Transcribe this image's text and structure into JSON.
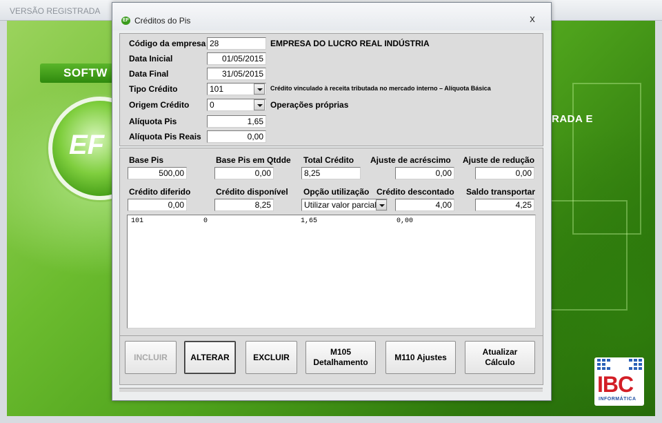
{
  "app": {
    "title": "VERSÃO REGISTRADA",
    "banner": "SOFTW",
    "logo": "EF",
    "side_text": "RADA E",
    "ibc_brand": "IBC",
    "ibc_sub": "INFORMÁTICA"
  },
  "dialog": {
    "title": "Créditos do Pis",
    "icon_text": "EF",
    "close": "x"
  },
  "header": {
    "codigo_label": "Código da empresa",
    "codigo_value": "28",
    "empresa_nome": "EMPRESA DO LUCRO REAL INDÚSTRIA",
    "data_inicial_label": "Data Inicial",
    "data_inicial_value": "01/05/2015",
    "data_final_label": "Data Final",
    "data_final_value": "31/05/2015",
    "tipo_credito_label": "Tipo Crédito",
    "tipo_credito_value": "101",
    "tipo_credito_desc": "Crédito vinculado à receita tributada no mercado interno – Alíquota Básica",
    "origem_label": "Origem Crédito",
    "origem_value": "0",
    "origem_desc": "Operações próprias",
    "aliquota_label": "Alíquota Pis",
    "aliquota_value": "1,65",
    "aliquota_reais_label": "Alíquota Pis Reais",
    "aliquota_reais_value": "0,00"
  },
  "calc": {
    "base_pis_label": "Base Pis",
    "base_pis_value": "500,00",
    "base_qtdde_label": "Base Pis em Qtdde",
    "base_qtdde_value": "0,00",
    "total_credito_label": "Total Crédito",
    "total_credito_value": "8,25",
    "ajuste_acrescimo_label": "Ajuste de acréscimo",
    "ajuste_acrescimo_value": "0,00",
    "ajuste_reducao_label": "Ajuste de redução",
    "ajuste_reducao_value": "0,00",
    "credito_diferido_label": "Crédito diferido",
    "credito_diferido_value": "0,00",
    "credito_disponivel_label": "Crédito disponível",
    "credito_disponivel_value": "8,25",
    "opcao_label": "Opção utilização",
    "opcao_value": "Utilizar valor parcial",
    "credito_descontado_label": "Crédito descontado",
    "credito_descontado_value": "4,00",
    "saldo_label": "Saldo transportar",
    "saldo_value": "4,25"
  },
  "grid": {
    "row1": [
      "101",
      "0",
      "1,65",
      "0,00"
    ]
  },
  "buttons": {
    "incluir": "INCLUIR",
    "alterar": "ALTERAR",
    "excluir": "EXCLUIR",
    "m105_line1": "M105",
    "m105_line2": "Detalhamento",
    "m110": "M110 Ajustes",
    "atualizar_line1": "Atualizar",
    "atualizar_line2": "Cálculo"
  }
}
